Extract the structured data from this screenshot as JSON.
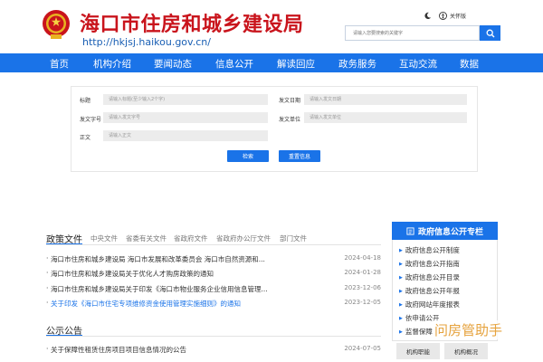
{
  "header": {
    "site_title": "海口市住房和城乡建设局",
    "site_url": "http://hkjsj.haikou.gov.cn/",
    "tools": [
      {
        "label": "",
        "icon": "moon-icon"
      },
      {
        "label": "关怀版",
        "icon": "accessibility-icon"
      }
    ],
    "search_placeholder": "请输入您要搜索的关键字"
  },
  "nav": [
    "首页",
    "机构介绍",
    "要闻动态",
    "信息公开",
    "解读回应",
    "政务服务",
    "互动交流",
    "数据"
  ],
  "search_form": {
    "fields": [
      {
        "label": "标题",
        "placeholder": "请输入标题(至少输入2个字)"
      },
      {
        "label": "发文日期",
        "placeholder": "请输入发文日期"
      },
      {
        "label": "发文字号",
        "placeholder": "请输入发文字号"
      },
      {
        "label": "发文单位",
        "placeholder": "请输入发文单位"
      },
      {
        "label": "正文",
        "placeholder": "请输入正文"
      }
    ],
    "search_button": "检索",
    "reset_button": "重置信息"
  },
  "policy": {
    "title": "政策文件",
    "tabs": [
      "中央文件",
      "省委有关文件",
      "省政府文件",
      "省政府办公厅文件",
      "部门文件"
    ],
    "items": [
      {
        "text": "海口市住房和城乡建设局 海口市发展和改革委员会 海口市自然资源和...",
        "date": "2024-04-18"
      },
      {
        "text": "海口市住房和城乡建设局关于优化人才购房政策的通知",
        "date": "2024-01-28"
      },
      {
        "text": "海口市住房和城乡建设局关于印发《海口市物业服务企业信用信息管理...",
        "date": "2023-12-06"
      },
      {
        "text": "关于印发《海口市住宅专项维修资金使用管理实施细则》的通知",
        "date": "2023-12-05"
      }
    ]
  },
  "notice": {
    "title": "公示公告",
    "items": [
      {
        "text": "关于保障性租赁住房项目项目信息情况的公告",
        "date": "2024-07-05"
      }
    ]
  },
  "sidebar": {
    "title": "政府信息公开专栏",
    "items": [
      "政府信息公开制度",
      "政府信息公开指南",
      "政府信息公开目录",
      "政府信息公开年报",
      "政府网站年度报表",
      "依申请公开",
      "监督保障"
    ],
    "buttons": [
      "机构职能",
      "机构概况"
    ]
  },
  "watermark": "问房管助手",
  "colors": {
    "brand_blue": "#1a73e8",
    "title_red": "#c9141c"
  }
}
